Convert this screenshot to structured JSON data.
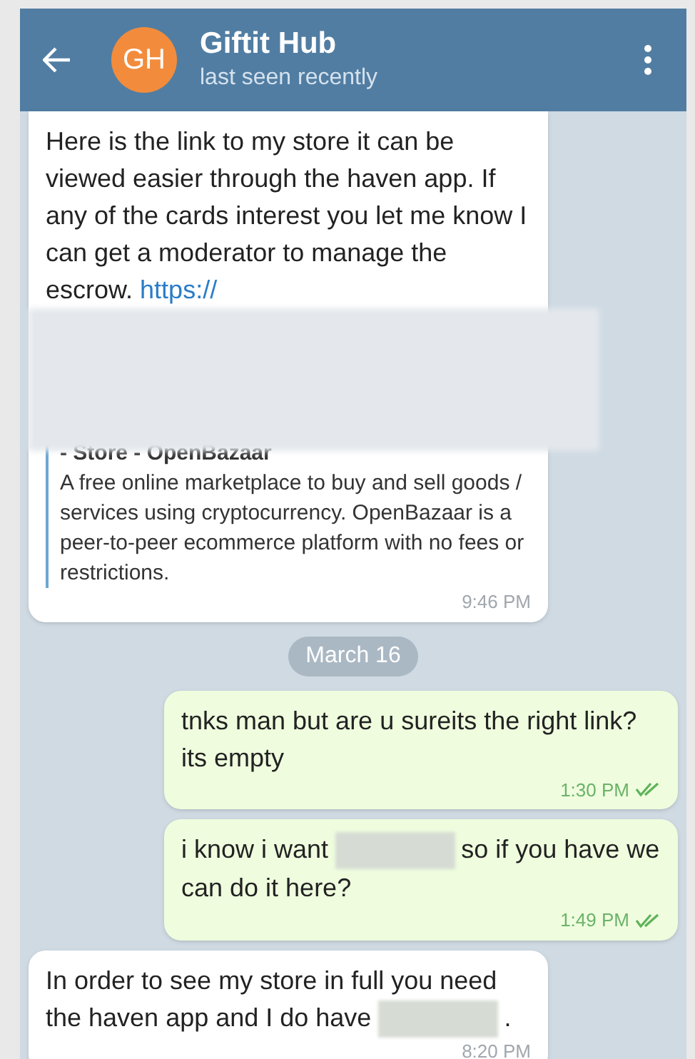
{
  "header": {
    "avatar_initials": "GH",
    "title": "Giftit Hub",
    "status": "last seen recently"
  },
  "messages": [
    {
      "kind": "incoming",
      "parts": [
        {
          "kind": "text",
          "text": "Here is the link to my store it can be viewed easier through the haven app. If any of the cards interest you let me know I can get a moderator to manage the escrow."
        },
        {
          "kind": "link",
          "text": "https://"
        }
      ],
      "redacted_block": true,
      "preview": {
        "title": "- Store - OpenBazaar",
        "description": "A free online marketplace to buy and sell goods / services using cryptocurrency. OpenBazaar is a peer-to-peer ecommerce platform with no fees or restrictions."
      },
      "time": "9:46 PM"
    },
    {
      "kind": "date",
      "text": "March 16"
    },
    {
      "kind": "outgoing",
      "parts": [
        {
          "kind": "text",
          "text": "tnks man but are u sureits the right link? its empty"
        }
      ],
      "time": "1:30 PM",
      "read": true
    },
    {
      "kind": "outgoing",
      "parts": [
        {
          "kind": "text",
          "text": "i know i want"
        },
        {
          "kind": "redacted"
        },
        {
          "kind": "text",
          "text": "so if you have we can do it here?"
        }
      ],
      "time": "1:49 PM",
      "read": true
    },
    {
      "kind": "incoming",
      "parts": [
        {
          "kind": "text",
          "text": "In order to see my store in full you need the haven app and I do have"
        },
        {
          "kind": "redacted"
        },
        {
          "kind": "text",
          "text": "."
        }
      ],
      "time": "8:20 PM"
    }
  ]
}
